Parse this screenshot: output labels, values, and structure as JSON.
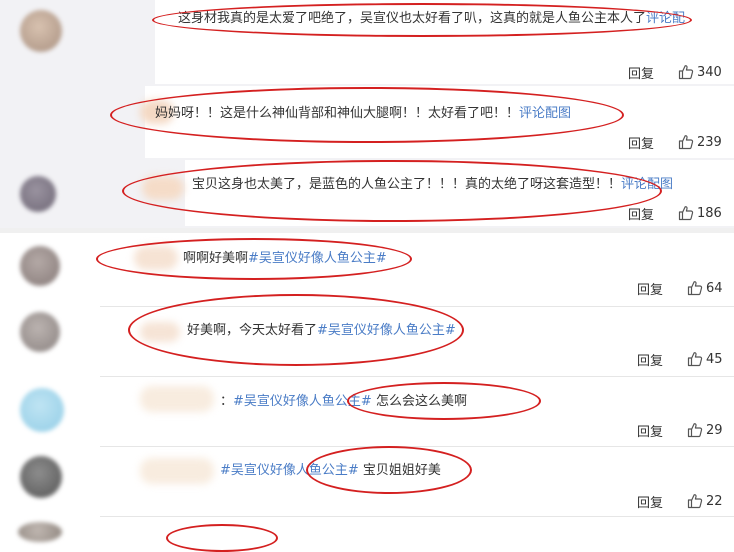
{
  "colors": {
    "link": "#4a7cc6",
    "highlight_ring": "#d42020"
  },
  "action_label": "回复",
  "comments": [
    {
      "segments": [
        {
          "text": "这身材我真的是太爱了吧绝了，吴宣仪也太好看了叭，这真的就是人鱼公主本人了",
          "link": false
        },
        {
          "text": "评论配",
          "link": true
        }
      ],
      "likes": "340"
    },
    {
      "segments": [
        {
          "text": "妈妈呀！！这是什么神仙背部和神仙大腿啊！！太好看了吧！！",
          "link": false
        },
        {
          "text": "评论配图",
          "link": true
        }
      ],
      "likes": "239"
    },
    {
      "segments": [
        {
          "text": "宝贝这身也太美了，是蓝色的人鱼公主了！！！真的太绝了呀这套造型！！",
          "link": false
        },
        {
          "text": "评论配图",
          "link": true
        }
      ],
      "likes": "186"
    },
    {
      "segments": [
        {
          "text": "啊啊好美啊",
          "link": false
        },
        {
          "text": "#吴宣仪好像人鱼公主#",
          "link": true
        }
      ],
      "likes": "64"
    },
    {
      "segments": [
        {
          "text": "好美啊，今天太好看了",
          "link": false
        },
        {
          "text": "#吴宣仪好像人鱼公主#",
          "link": true
        }
      ],
      "likes": "45"
    },
    {
      "segments": [
        {
          "text": "：",
          "link": false
        },
        {
          "text": "#吴宣仪好像人鱼公主#",
          "link": true
        },
        {
          "text": " 怎么会这么美啊",
          "link": false
        }
      ],
      "likes": "29"
    },
    {
      "segments": [
        {
          "text": "#吴宣仪好像人鱼公主#",
          "link": true
        },
        {
          "text": " 宝贝姐姐好美",
          "link": false
        }
      ],
      "likes": "22"
    }
  ]
}
